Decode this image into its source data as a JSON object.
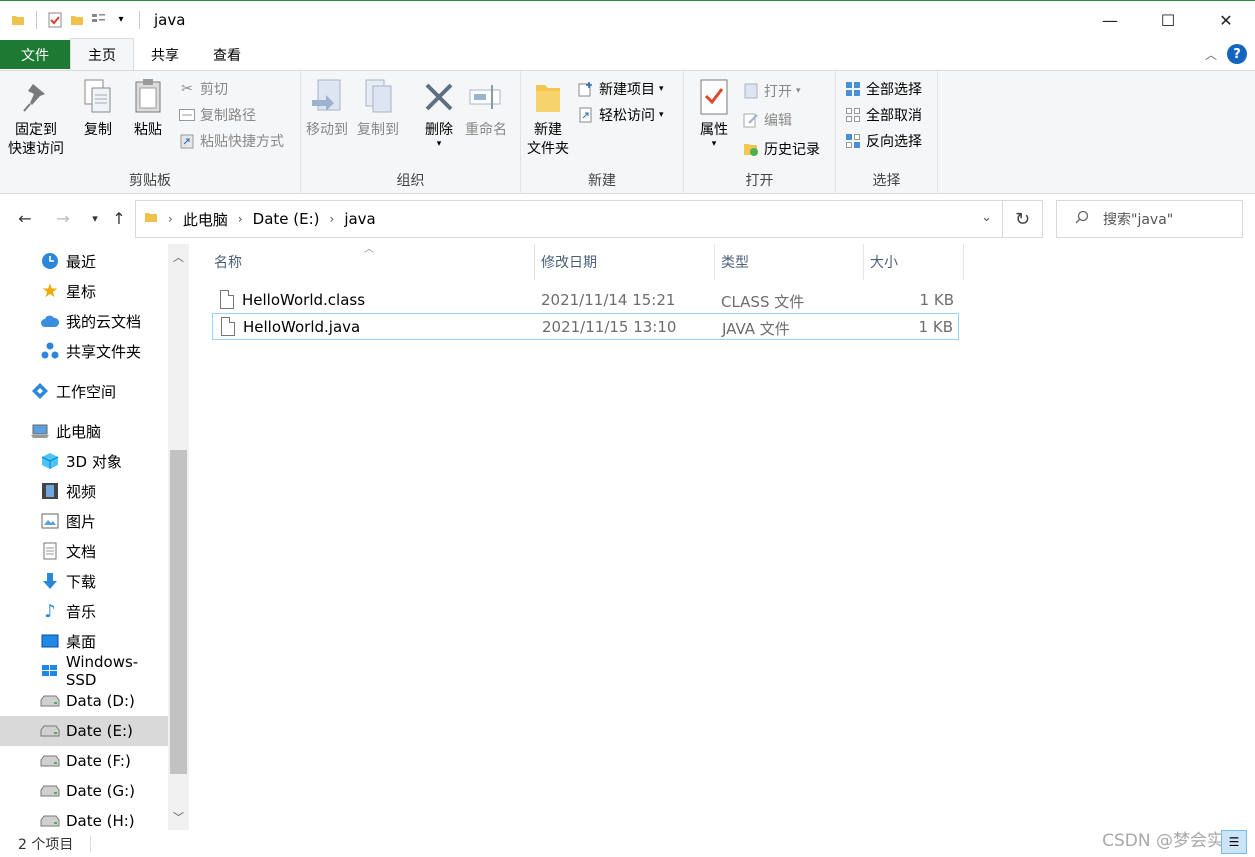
{
  "window": {
    "title": "java"
  },
  "window_controls": {
    "minimize": "—",
    "maximize": "☐",
    "close": "✕"
  },
  "tabs": [
    {
      "label": "文件"
    },
    {
      "label": "主页"
    },
    {
      "label": "共享"
    },
    {
      "label": "查看"
    }
  ],
  "ribbon": {
    "clipboard": {
      "label": "剪贴板",
      "pin_line1": "固定到",
      "pin_line2": "快速访问",
      "copy": "复制",
      "paste": "粘贴",
      "cut": "剪切",
      "copy_path": "复制路径",
      "paste_shortcut": "粘贴快捷方式"
    },
    "organize": {
      "label": "组织",
      "move_to": "移动到",
      "copy_to": "复制到",
      "delete": "删除",
      "rename": "重命名"
    },
    "new": {
      "label": "新建",
      "new_folder_line1": "新建",
      "new_folder_line2": "文件夹",
      "new_item": "新建项目",
      "easy_access": "轻松访问"
    },
    "open": {
      "label": "打开",
      "properties": "属性",
      "open": "打开",
      "edit": "编辑",
      "history": "历史记录"
    },
    "select": {
      "label": "选择",
      "select_all": "全部选择",
      "select_none": "全部取消",
      "invert": "反向选择"
    }
  },
  "address": {
    "segments": [
      "此电脑",
      "Date (E:)",
      "java"
    ],
    "search_placeholder": "搜索\"java\""
  },
  "sidebar": {
    "items": [
      {
        "label": "最近",
        "icon": "clock-icon"
      },
      {
        "label": "星标",
        "icon": "star-icon"
      },
      {
        "label": "我的云文档",
        "icon": "cloud-icon"
      },
      {
        "label": "共享文件夹",
        "icon": "share-icon"
      },
      {
        "label": "工作空间",
        "icon": "workspace-icon"
      },
      {
        "label": "此电脑",
        "icon": "computer-icon"
      },
      {
        "label": "3D 对象",
        "icon": "cube-icon"
      },
      {
        "label": "视频",
        "icon": "video-icon"
      },
      {
        "label": "图片",
        "icon": "picture-icon"
      },
      {
        "label": "文档",
        "icon": "document-icon"
      },
      {
        "label": "下载",
        "icon": "download-icon"
      },
      {
        "label": "音乐",
        "icon": "music-icon"
      },
      {
        "label": "桌面",
        "icon": "desktop-icon"
      },
      {
        "label": "Windows-SSD",
        "icon": "windows-drive-icon"
      },
      {
        "label": "Data (D:)",
        "icon": "drive-icon"
      },
      {
        "label": "Date (E:)",
        "icon": "drive-icon"
      },
      {
        "label": "Date (F:)",
        "icon": "drive-icon"
      },
      {
        "label": "Date (G:)",
        "icon": "drive-icon"
      },
      {
        "label": "Date (H:)",
        "icon": "drive-icon"
      }
    ]
  },
  "file_list": {
    "columns": [
      "名称",
      "修改日期",
      "类型",
      "大小"
    ],
    "rows": [
      {
        "name": "HelloWorld.class",
        "date": "2021/11/14 15:21",
        "type": "CLASS 文件",
        "size": "1 KB"
      },
      {
        "name": "HelloWorld.java",
        "date": "2021/11/15 13:10",
        "type": "JAVA 文件",
        "size": "1 KB"
      }
    ]
  },
  "status": {
    "count": "2 个项目"
  },
  "watermark": "CSDN @梦会实现",
  "colors": {
    "file_tab": "#1e7a33",
    "accent": "#1565c0",
    "selection_border": "#99d1ff"
  }
}
